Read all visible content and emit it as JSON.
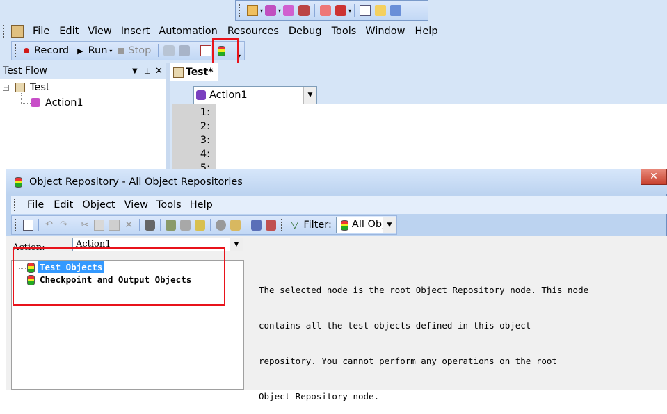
{
  "main_menu": {
    "file": "File",
    "edit": "Edit",
    "view": "View",
    "insert": "Insert",
    "automation": "Automation",
    "resources": "Resources",
    "debug": "Debug",
    "tools": "Tools",
    "window": "Window",
    "help": "Help"
  },
  "run_toolbar": {
    "record": "Record",
    "run": "Run",
    "stop": "Stop"
  },
  "test_flow": {
    "title": "Test Flow",
    "root": "Test",
    "child": "Action1"
  },
  "document_tab": {
    "label": "Test*"
  },
  "editor": {
    "action_select": "Action1",
    "line_numbers": [
      "1:",
      "2:",
      "3:",
      "4:",
      "5:"
    ]
  },
  "object_repository": {
    "title": "Object Repository - All Object Repositories",
    "menu": {
      "file": "File",
      "edit": "Edit",
      "object": "Object",
      "view": "View",
      "tools": "Tools",
      "help": "Help"
    },
    "filter_label": "Filter:",
    "filter_value": "All Obj",
    "action_label": "Action:",
    "action_value": "Action1",
    "tree": {
      "test_objects": "Test Objects",
      "checkpoints": "Checkpoint and Output Objects"
    },
    "description": [
      "The selected node is the root Object Repository node. This node",
      "contains all the test objects defined in this object",
      "repository. You cannot perform any operations on the root",
      "Object Repository node."
    ]
  },
  "colors": {
    "highlight_box": "#e8131b",
    "selection": "#3399ff",
    "toolbar": "#c8dcf7"
  }
}
